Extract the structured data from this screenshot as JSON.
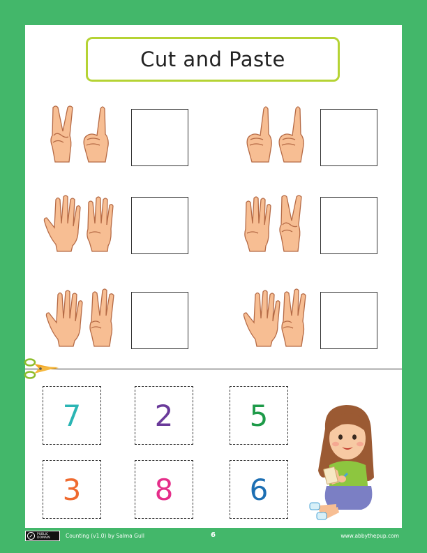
{
  "title": "Cut and Paste",
  "colors": {
    "background": "#43b76a",
    "title_border": "#b5d334",
    "skin": "#f7be93",
    "skin_outline": "#b56a45"
  },
  "problems": [
    {
      "hands": [
        "two",
        "one"
      ]
    },
    {
      "hands": [
        "one",
        "one"
      ]
    },
    {
      "hands": [
        "five",
        "four"
      ]
    },
    {
      "hands": [
        "four",
        "two"
      ]
    },
    {
      "hands": [
        "five",
        "three"
      ]
    },
    {
      "hands": [
        "five",
        "three"
      ]
    }
  ],
  "number_cards": [
    {
      "value": "7",
      "color": "#2bb5b4"
    },
    {
      "value": "2",
      "color": "#6a3a9a"
    },
    {
      "value": "5",
      "color": "#1d9a48"
    },
    {
      "value": "3",
      "color": "#ef6a2f"
    },
    {
      "value": "8",
      "color": "#e52e8a"
    },
    {
      "value": "6",
      "color": "#1d6fb3"
    }
  ],
  "footer": {
    "license_line1": "PUBLIC",
    "license_line2": "DOMAIN",
    "credit": "Counting (v1.0) by Salma Gull",
    "page_number": "6",
    "website": "www.abbythepup.com"
  }
}
